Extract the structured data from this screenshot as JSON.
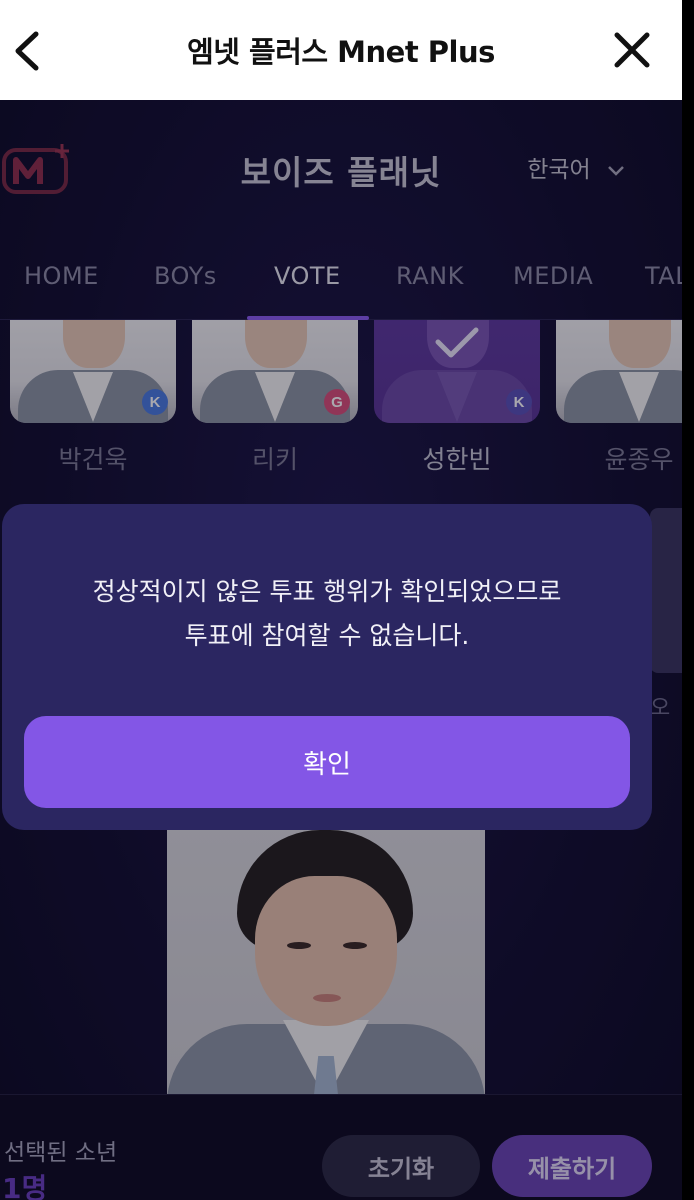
{
  "topbar": {
    "title": "엠넷 플러스 Mnet Plus"
  },
  "header": {
    "brand": "보이즈 플래닛",
    "language": "한국어"
  },
  "nav": {
    "items": [
      {
        "label": "HOME"
      },
      {
        "label": "BOYs"
      },
      {
        "label": "VOTE"
      },
      {
        "label": "RANK"
      },
      {
        "label": "MEDIA"
      },
      {
        "label": "TAL"
      }
    ],
    "active": "VOTE"
  },
  "candidates": [
    {
      "name": "박건욱",
      "badge": "K",
      "badge_color": "#4a7be0",
      "selected": false
    },
    {
      "name": "리키",
      "badge": "G",
      "badge_color": "#d94f7a",
      "selected": false
    },
    {
      "name": "성한빈",
      "badge": "K",
      "badge_color": "#5a52b8",
      "selected": true
    },
    {
      "name": "윤종우",
      "badge": "",
      "badge_color": "",
      "selected": false
    }
  ],
  "background": {
    "side_text": "오"
  },
  "bottom": {
    "selected_label": "선택된 소년",
    "selected_count": "1명",
    "reset_label": "초기화",
    "submit_label": "제출하기"
  },
  "modal": {
    "message": "정상적이지 않은 투표 행위가 확인되었으므로\n투표에 참여할 수 없습니다.",
    "confirm_label": "확인"
  },
  "colors": {
    "accent": "#8356e6",
    "background": "#120f30",
    "modal_bg": "#2b2661"
  }
}
